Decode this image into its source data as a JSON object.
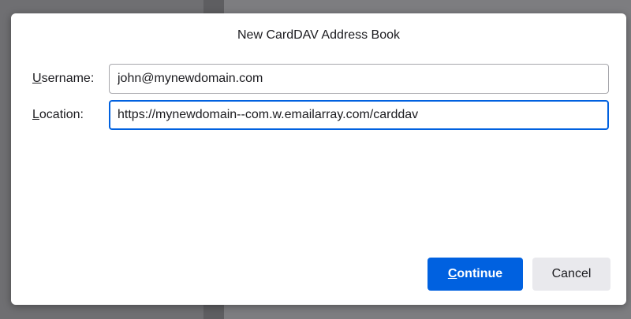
{
  "dialog": {
    "title": "New CardDAV Address Book",
    "username": {
      "label_access_key": "U",
      "label_rest": "sername:",
      "value": "john@mynewdomain.com"
    },
    "location": {
      "label_access_key": "L",
      "label_rest": "ocation:",
      "value": "https://mynewdomain--com.w.emailarray.com/carddav"
    },
    "buttons": {
      "continue_access_key": "C",
      "continue_rest": "ontinue",
      "cancel_label": "Cancel"
    }
  },
  "colors": {
    "primary_button": "#0061e0",
    "secondary_button": "#e9e9ed",
    "focus_border": "#0061e0"
  }
}
